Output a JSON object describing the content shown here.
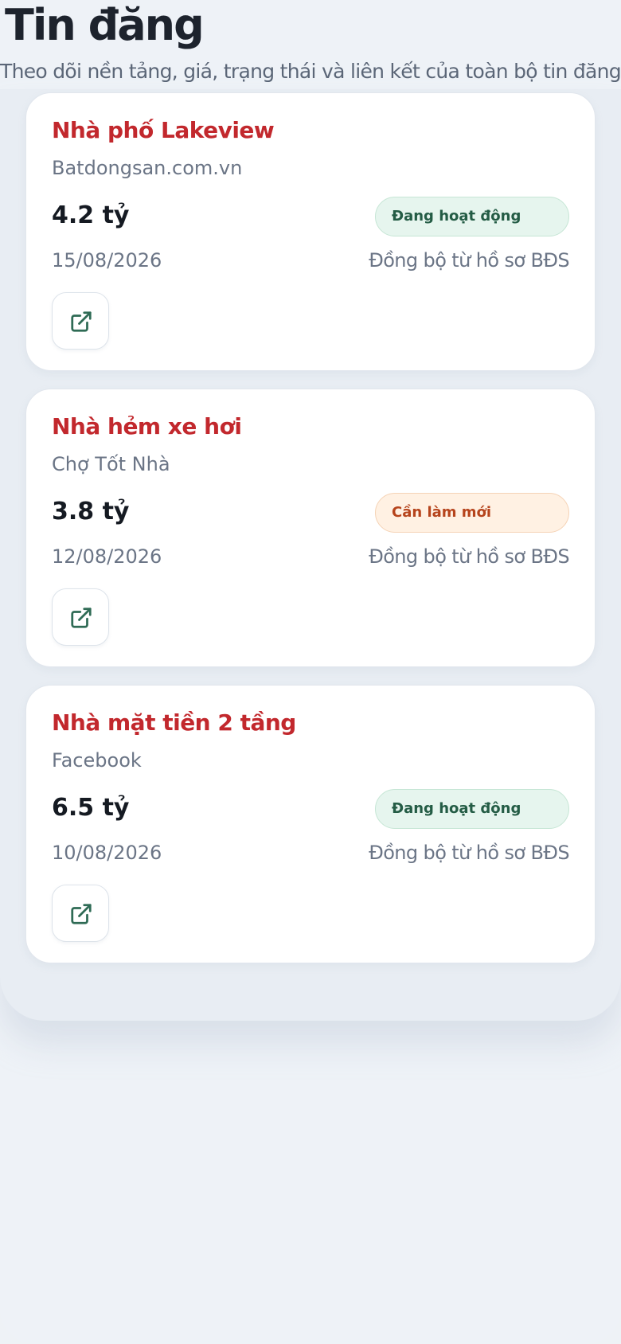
{
  "header": {
    "title": "Tin đăng",
    "subtitle": "Theo dõi nền tảng, giá, trạng thái và liên kết của toàn bộ tin đăng."
  },
  "listings": [
    {
      "title": "Nhà phố Lakeview",
      "platform": "Batdongsan.com.vn",
      "price": "4.2 tỷ",
      "status": "Đang hoạt động",
      "status_type": "active",
      "date": "15/08/2026",
      "sync": "Đồng bộ từ hồ sơ BĐS",
      "link_icon": "external-link-icon"
    },
    {
      "title": "Nhà hẻm xe hơi",
      "platform": "Chợ Tốt Nhà",
      "price": "3.8 tỷ",
      "status": "Cần làm mới",
      "status_type": "refresh",
      "date": "12/08/2026",
      "sync": "Đồng bộ từ hồ sơ BĐS",
      "link_icon": "external-link-icon"
    },
    {
      "title": "Nhà mặt tiền 2 tầng",
      "platform": "Facebook",
      "price": "6.5 tỷ",
      "status": "Đang hoạt động",
      "status_type": "active",
      "date": "10/08/2026",
      "sync": "Đồng bộ từ hồ sơ BĐS",
      "link_icon": "external-link-icon"
    }
  ],
  "colors": {
    "title_red": "#c2282d",
    "active_bg": "#e6f5ee",
    "active_text": "#245c45",
    "refresh_bg": "#fff1e3",
    "refresh_text": "#b6441c",
    "icon_green": "#2f6b55"
  }
}
